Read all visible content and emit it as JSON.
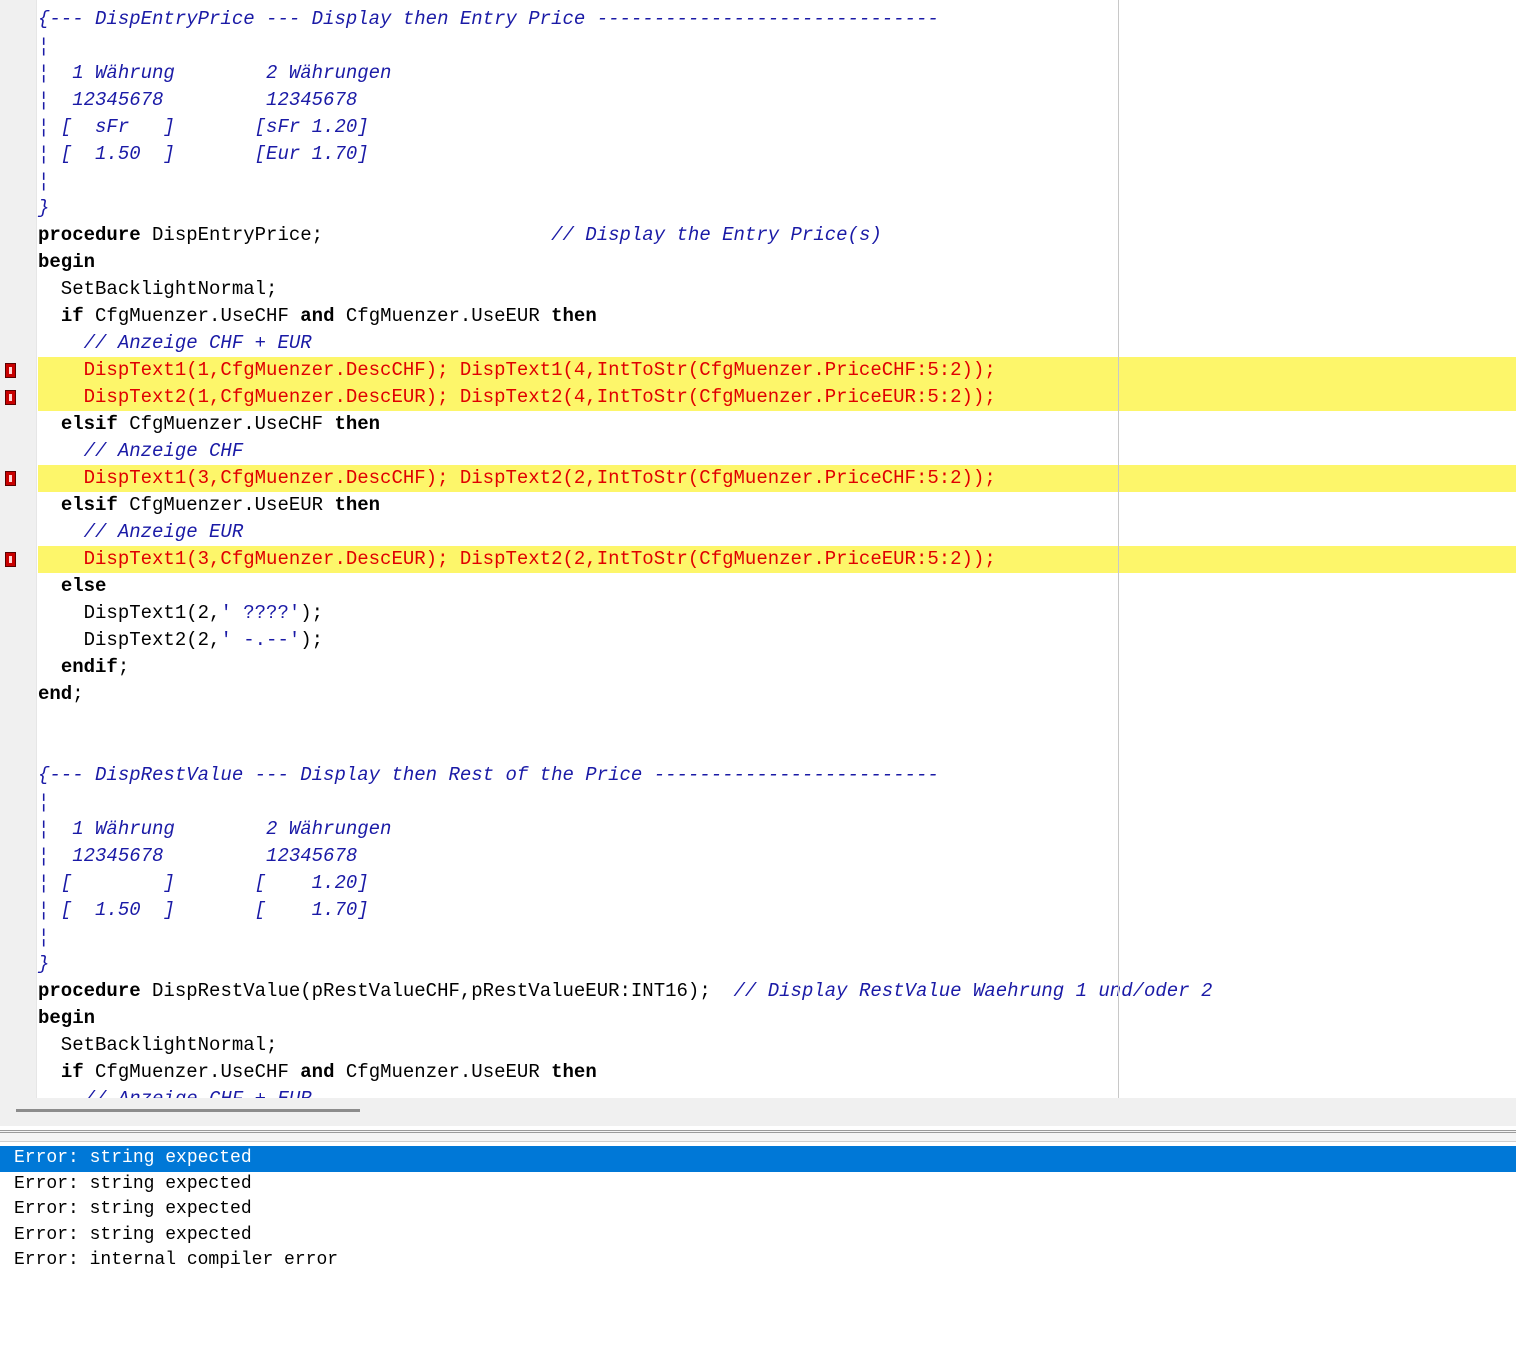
{
  "editor": {
    "lines": [
      {
        "segments": [
          {
            "t": "{--- DispEntryPrice --- Display then Entry Price ------------------------------",
            "c": "cm"
          }
        ]
      },
      {
        "segments": [
          {
            "t": "¦",
            "c": "cm"
          }
        ]
      },
      {
        "segments": [
          {
            "t": "¦  1 Währung        2 Währungen",
            "c": "cm"
          }
        ]
      },
      {
        "segments": [
          {
            "t": "¦  12345678         12345678",
            "c": "cm"
          }
        ]
      },
      {
        "segments": [
          {
            "t": "¦ [  sFr   ]       [sFr 1.20]",
            "c": "cm"
          }
        ]
      },
      {
        "segments": [
          {
            "t": "¦ [  1.50  ]       [Eur 1.70]",
            "c": "cm"
          }
        ]
      },
      {
        "segments": [
          {
            "t": "¦",
            "c": "cm"
          }
        ]
      },
      {
        "segments": [
          {
            "t": "}",
            "c": "cm"
          }
        ]
      },
      {
        "segments": [
          {
            "t": "procedure",
            "c": "kw"
          },
          {
            "t": " DispEntryPrice;                    ",
            "c": "id"
          },
          {
            "t": "// Display the Entry Price(s)",
            "c": "cm"
          }
        ]
      },
      {
        "segments": [
          {
            "t": "begin",
            "c": "kw"
          }
        ]
      },
      {
        "segments": [
          {
            "t": "  SetBacklightNormal;",
            "c": "id"
          }
        ]
      },
      {
        "segments": [
          {
            "t": "  ",
            "c": "id"
          },
          {
            "t": "if",
            "c": "kw"
          },
          {
            "t": " CfgMuenzer.UseCHF ",
            "c": "id"
          },
          {
            "t": "and",
            "c": "kw"
          },
          {
            "t": " CfgMuenzer.UseEUR ",
            "c": "id"
          },
          {
            "t": "then",
            "c": "kw"
          }
        ]
      },
      {
        "segments": [
          {
            "t": "    // Anzeige CHF + EUR",
            "c": "cm"
          }
        ]
      },
      {
        "highlight": true,
        "marker": true,
        "segments": [
          {
            "t": "    DispText1(1,CfgMuenzer.DescCHF); DispText1(4,IntToStr(CfgMuenzer.PriceCHF:5:2));",
            "c": "er"
          }
        ]
      },
      {
        "highlight": true,
        "marker": true,
        "segments": [
          {
            "t": "    DispText2(1,CfgMuenzer.DescEUR); DispText2(4,IntToStr(CfgMuenzer.PriceEUR:5:2));",
            "c": "er"
          }
        ]
      },
      {
        "segments": [
          {
            "t": "  ",
            "c": "id"
          },
          {
            "t": "elsif",
            "c": "kw"
          },
          {
            "t": " CfgMuenzer.UseCHF ",
            "c": "id"
          },
          {
            "t": "then",
            "c": "kw"
          }
        ]
      },
      {
        "segments": [
          {
            "t": "    // Anzeige CHF",
            "c": "cm"
          }
        ]
      },
      {
        "highlight": true,
        "marker": true,
        "segments": [
          {
            "t": "    DispText1(3,CfgMuenzer.DescCHF); DispText2(2,IntToStr(CfgMuenzer.PriceCHF:5:2));",
            "c": "er"
          }
        ]
      },
      {
        "segments": [
          {
            "t": "  ",
            "c": "id"
          },
          {
            "t": "elsif",
            "c": "kw"
          },
          {
            "t": " CfgMuenzer.UseEUR ",
            "c": "id"
          },
          {
            "t": "then",
            "c": "kw"
          }
        ]
      },
      {
        "segments": [
          {
            "t": "    // Anzeige EUR",
            "c": "cm"
          }
        ]
      },
      {
        "highlight": true,
        "marker": true,
        "segments": [
          {
            "t": "    DispText1(3,CfgMuenzer.DescEUR); DispText2(2,IntToStr(CfgMuenzer.PriceEUR:5:2));",
            "c": "er"
          }
        ]
      },
      {
        "segments": [
          {
            "t": "  ",
            "c": "id"
          },
          {
            "t": "else",
            "c": "kw"
          }
        ]
      },
      {
        "segments": [
          {
            "t": "    DispText1(2,",
            "c": "id"
          },
          {
            "t": "' ????'",
            "c": "st"
          },
          {
            "t": ");",
            "c": "id"
          }
        ]
      },
      {
        "segments": [
          {
            "t": "    DispText2(2,",
            "c": "id"
          },
          {
            "t": "' -.--'",
            "c": "st"
          },
          {
            "t": ");",
            "c": "id"
          }
        ]
      },
      {
        "segments": [
          {
            "t": "  ",
            "c": "id"
          },
          {
            "t": "endif",
            "c": "kw"
          },
          {
            "t": ";",
            "c": "id"
          }
        ]
      },
      {
        "segments": [
          {
            "t": "end",
            "c": "kw"
          },
          {
            "t": ";",
            "c": "id"
          }
        ]
      },
      {
        "segments": []
      },
      {
        "segments": []
      },
      {
        "segments": [
          {
            "t": "{--- DispRestValue --- Display then Rest of the Price -------------------------",
            "c": "cm"
          }
        ]
      },
      {
        "segments": [
          {
            "t": "¦",
            "c": "cm"
          }
        ]
      },
      {
        "segments": [
          {
            "t": "¦  1 Währung        2 Währungen",
            "c": "cm"
          }
        ]
      },
      {
        "segments": [
          {
            "t": "¦  12345678         12345678",
            "c": "cm"
          }
        ]
      },
      {
        "segments": [
          {
            "t": "¦ [        ]       [    1.20]",
            "c": "cm"
          }
        ]
      },
      {
        "segments": [
          {
            "t": "¦ [  1.50  ]       [    1.70]",
            "c": "cm"
          }
        ]
      },
      {
        "segments": [
          {
            "t": "¦",
            "c": "cm"
          }
        ]
      },
      {
        "segments": [
          {
            "t": "}",
            "c": "cm"
          }
        ]
      },
      {
        "segments": [
          {
            "t": "procedure",
            "c": "kw"
          },
          {
            "t": " DispRestValue(pRestValueCHF,pRestValueEUR:INT16);  ",
            "c": "id"
          },
          {
            "t": "// Display RestValue Waehrung 1 und/oder 2",
            "c": "cm"
          }
        ]
      },
      {
        "segments": [
          {
            "t": "begin",
            "c": "kw"
          }
        ]
      },
      {
        "segments": [
          {
            "t": "  SetBacklightNormal;",
            "c": "id"
          }
        ]
      },
      {
        "segments": [
          {
            "t": "  ",
            "c": "id"
          },
          {
            "t": "if",
            "c": "kw"
          },
          {
            "t": " CfgMuenzer.UseCHF ",
            "c": "id"
          },
          {
            "t": "and",
            "c": "kw"
          },
          {
            "t": " CfgMuenzer.UseEUR ",
            "c": "id"
          },
          {
            "t": "then",
            "c": "kw"
          }
        ]
      },
      {
        "segments": [
          {
            "t": "    // Anzeige CHF + EUR",
            "c": "cm"
          }
        ]
      }
    ]
  },
  "messages": [
    {
      "text": "Error: string expected",
      "selected": true
    },
    {
      "text": "Error: string expected",
      "selected": false
    },
    {
      "text": "Error: string expected",
      "selected": false
    },
    {
      "text": "Error: string expected",
      "selected": false
    },
    {
      "text": "Error: internal compiler error",
      "selected": false
    }
  ],
  "colors": {
    "keyword": "#000000",
    "comment": "#1a1aa6",
    "error_text": "#e00000",
    "error_highlight": "#fdf66a",
    "selection": "#0078d7"
  }
}
